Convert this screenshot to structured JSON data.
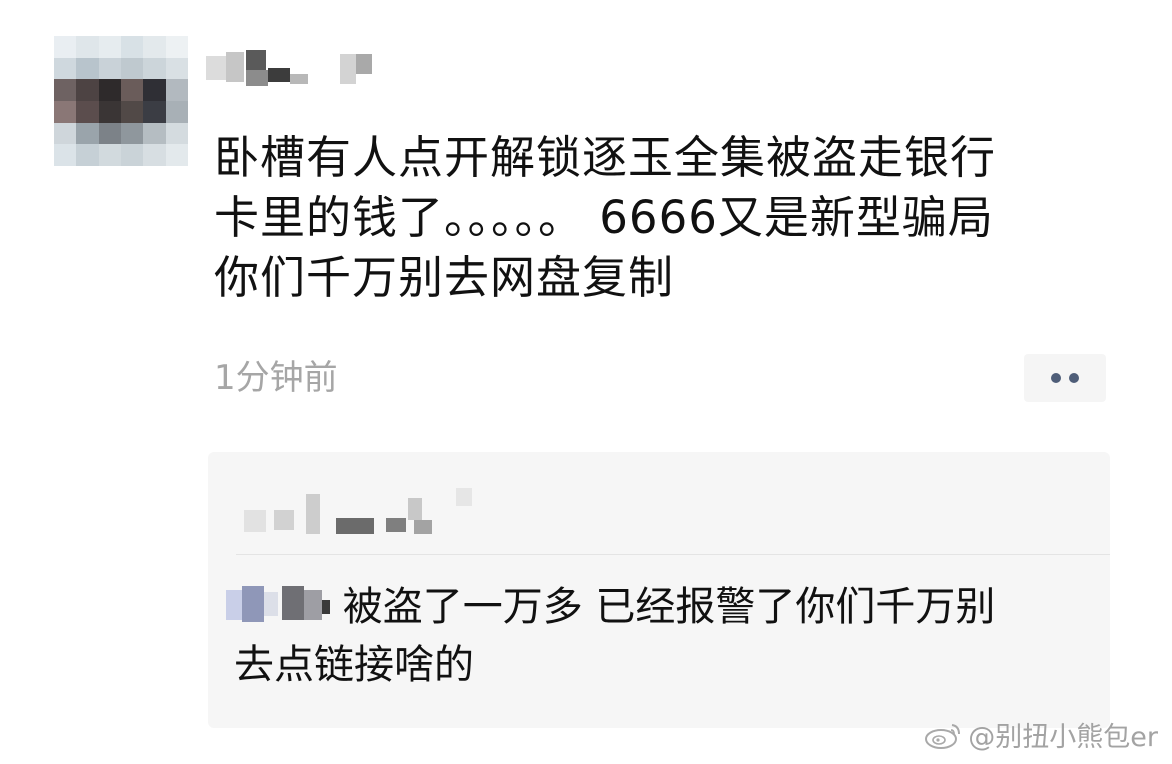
{
  "post": {
    "text_lines": [
      "卧槽有人点开解锁逐玉全集被盗走银行",
      "卡里的钱了。。。。。 6666又是新型骗局",
      "你们千万别去网盘复制"
    ],
    "timestamp": "1分钟前",
    "more_icon": "ellipsis-icon"
  },
  "comment": {
    "text_line1": "被盗了一万多 已经报警了你们千万别",
    "text_line2": "去点链接啥的"
  },
  "watermark": {
    "text": "@别扭小熊包er",
    "icon": "weibo-logo"
  },
  "colors": {
    "timestamp": "#a6a6a6",
    "comment_bg": "#f6f6f6",
    "more_dots": "#4e5d78"
  }
}
